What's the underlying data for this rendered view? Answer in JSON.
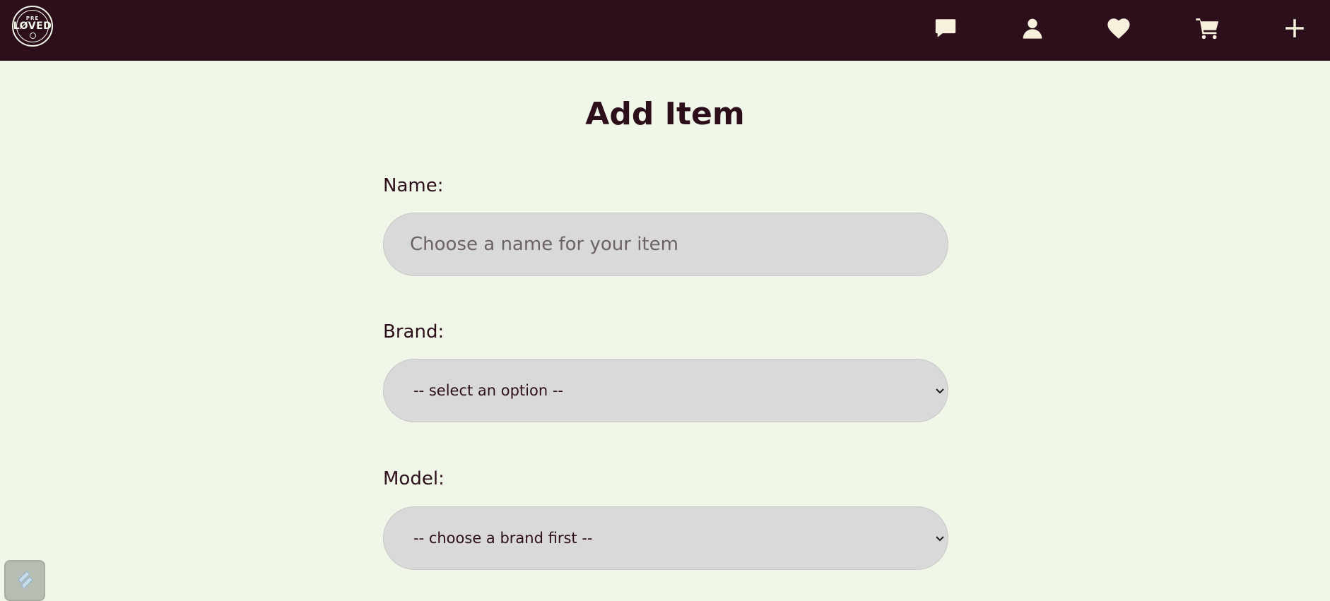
{
  "header": {
    "logo": {
      "top_text": "PRE",
      "word": "LØVED"
    },
    "icons": [
      "chat-icon",
      "user-icon",
      "heart-icon",
      "cart-icon",
      "plus-icon"
    ]
  },
  "page": {
    "title": "Add Item"
  },
  "form": {
    "name": {
      "label": "Name:",
      "placeholder": "Choose a name for your item"
    },
    "brand": {
      "label": "Brand:",
      "value": "-- select an option --"
    },
    "model": {
      "label": "Model:",
      "value": "-- choose a brand first --"
    }
  },
  "colors": {
    "navbar": "#2d0f1c",
    "background": "#f0f7e8",
    "field": "#d9d9d9",
    "icon": "#f6f0dc"
  }
}
